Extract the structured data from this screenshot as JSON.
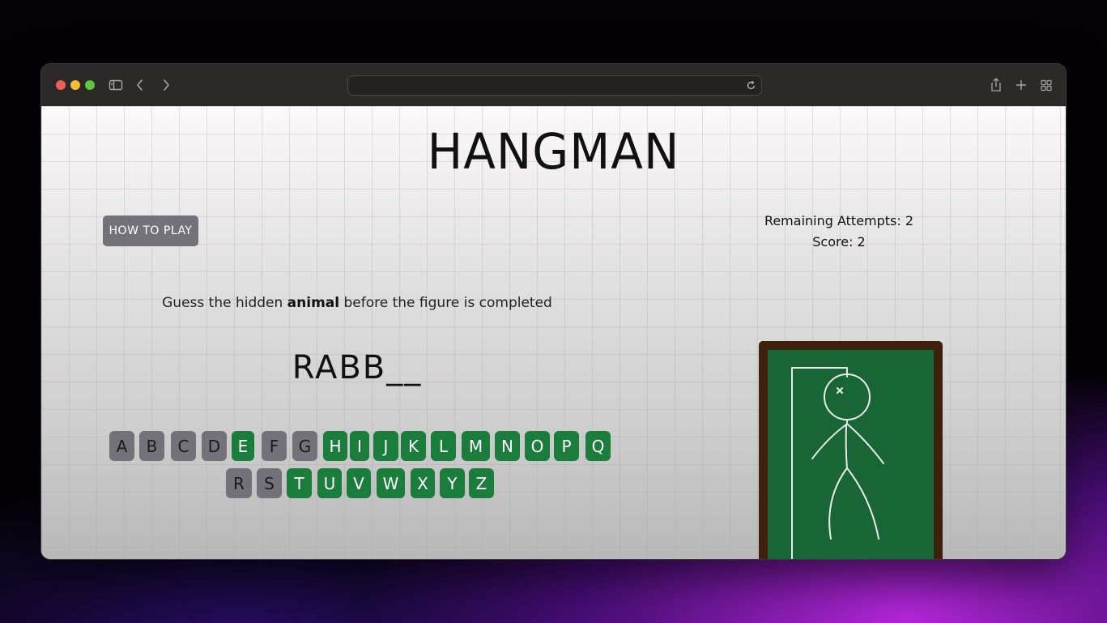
{
  "game": {
    "title": "HANGMAN",
    "how_to_play_label": "HOW TO PLAY",
    "remaining_attempts_label": "Remaining Attempts: 2",
    "score_label": "Score: 2",
    "instruction_prefix": "Guess the hidden",
    "instruction_category": "animal",
    "instruction_suffix": "before the figure is completed",
    "word_display": "RABB__",
    "keyboard_row1": [
      {
        "letter": "A",
        "state": "used"
      },
      {
        "letter": "B",
        "state": "used"
      },
      {
        "letter": "C",
        "state": "used"
      },
      {
        "letter": "D",
        "state": "used"
      },
      {
        "letter": "E",
        "state": "available"
      },
      {
        "letter": "F",
        "state": "used"
      },
      {
        "letter": "G",
        "state": "used"
      },
      {
        "letter": "H",
        "state": "available"
      },
      {
        "letter": "I",
        "state": "available"
      },
      {
        "letter": "J",
        "state": "available"
      },
      {
        "letter": "K",
        "state": "available"
      },
      {
        "letter": "L",
        "state": "available"
      },
      {
        "letter": "M",
        "state": "available"
      },
      {
        "letter": "N",
        "state": "available"
      },
      {
        "letter": "O",
        "state": "available"
      },
      {
        "letter": "P",
        "state": "available"
      },
      {
        "letter": "Q",
        "state": "available"
      }
    ],
    "keyboard_row2": [
      {
        "letter": "R",
        "state": "used"
      },
      {
        "letter": "S",
        "state": "used"
      },
      {
        "letter": "T",
        "state": "available"
      },
      {
        "letter": "U",
        "state": "available"
      },
      {
        "letter": "V",
        "state": "available"
      },
      {
        "letter": "W",
        "state": "available"
      },
      {
        "letter": "X",
        "state": "available"
      },
      {
        "letter": "Y",
        "state": "available"
      },
      {
        "letter": "Z",
        "state": "available"
      }
    ],
    "colors": {
      "used_key": "#737279",
      "available_key": "#1a7d3c",
      "board_frame": "#3f200c",
      "board_surface": "#186535"
    }
  },
  "browser": {
    "icons": [
      "sidebar-icon",
      "back-icon",
      "forward-icon",
      "reload-icon",
      "share-icon",
      "new-tab-icon",
      "tab-overview-icon"
    ]
  }
}
